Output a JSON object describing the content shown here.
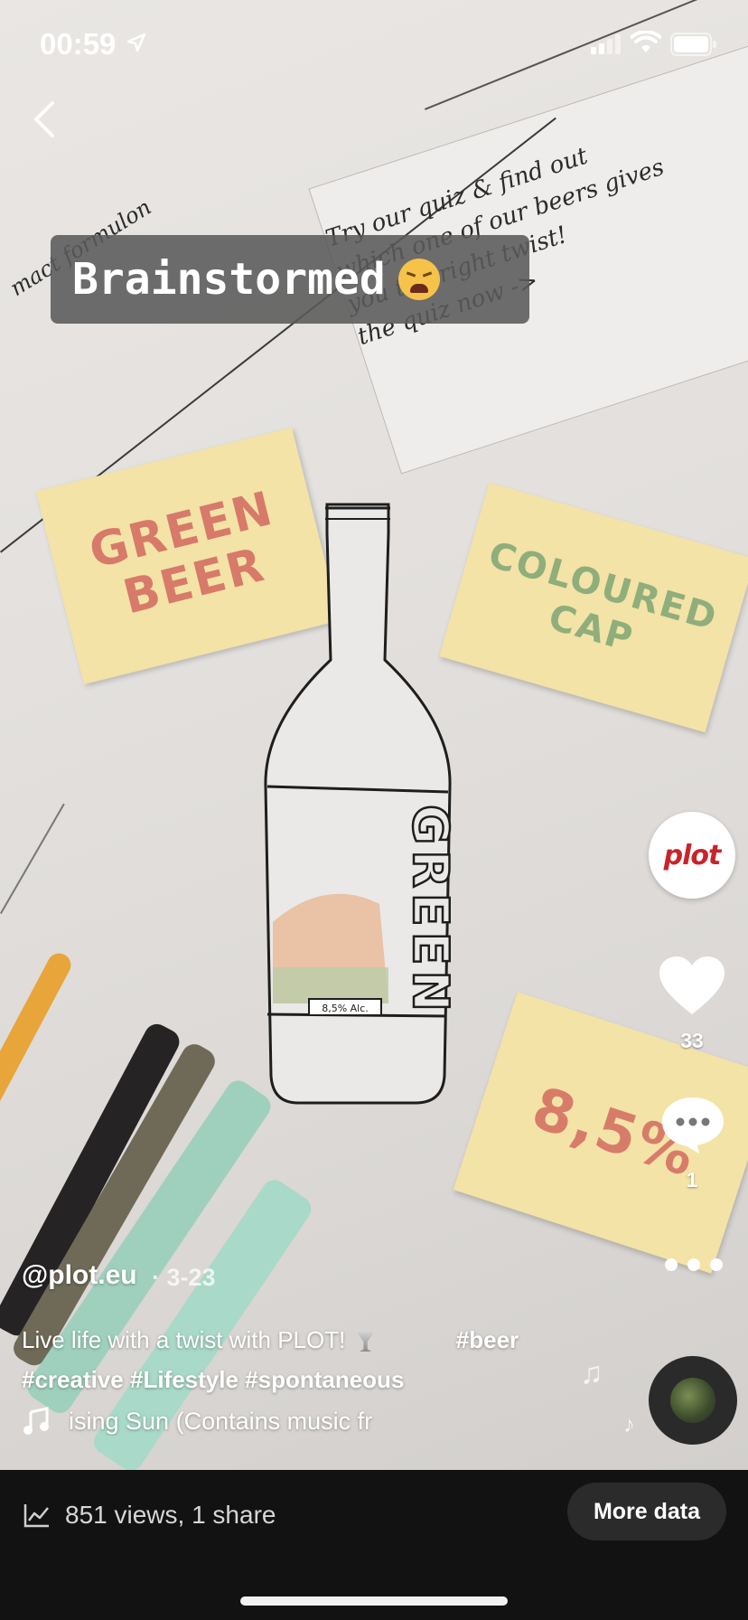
{
  "status_bar": {
    "time": "00:59"
  },
  "caption": {
    "text": "Brainstormed",
    "emoji": "weary-face-emoji"
  },
  "video": {
    "sticky_notes": {
      "green_beer": "GREEN\nBEER",
      "coloured_cap": "COLOURED\nCAP",
      "percent": "8,5%"
    },
    "handwritten_note": "Try our quiz & find out\nwhich one of our beers gives\nyou the right twist!\nthe quiz now ->",
    "handwritten_left": "mact formulon",
    "bottle_label": "GREEN",
    "bottle_abv": "8,5% Alc."
  },
  "right_rail": {
    "avatar_logo": "plot",
    "likes": "33",
    "comments": "1"
  },
  "post": {
    "username": "@plot.eu",
    "date": "· 3-23",
    "description_pre": "Live life with a twist with PLOT! ",
    "description_hashtag1": "#beer",
    "description_line2": "#creative #Lifestyle #spontaneous",
    "music": "ising Sun (Contains music fr"
  },
  "bottom_bar": {
    "stats": "851 views, 1 share",
    "more_data_label": "More data"
  }
}
